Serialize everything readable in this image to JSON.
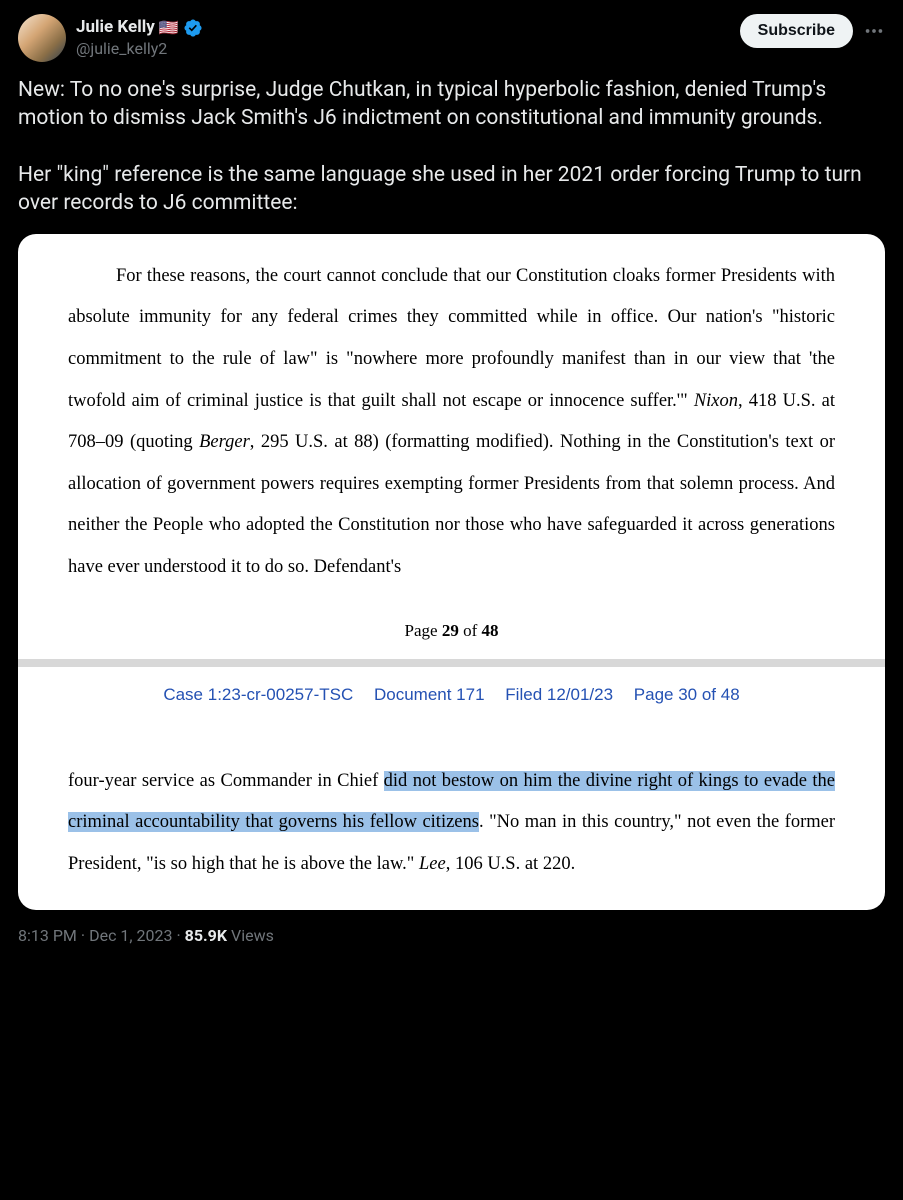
{
  "header": {
    "display_name": "Julie Kelly",
    "flag": "🇺🇸",
    "handle": "@julie_kelly2",
    "subscribe_label": "Subscribe"
  },
  "tweet": {
    "text": "New: To no one's surprise, Judge Chutkan, in typical hyperbolic fashion, denied Trump's motion to dismiss Jack Smith's J6 indictment on constitutional and immunity grounds.\n\nHer \"king\" reference is the same language she used in her 2021 order forcing Trump to turn over records to J6 committee:"
  },
  "document": {
    "page1": {
      "pre_nixon": "For these reasons, the court cannot conclude that our Constitution cloaks former Presidents with absolute immunity for any federal crimes they committed while in office.  Our nation's \"historic commitment to the rule of law\" is \"nowhere more profoundly manifest than in our view that 'the twofold aim of criminal justice is that guilt shall not escape or innocence suffer.'\"  ",
      "nixon_cite_name": "Nixon",
      "nixon_cite_rest": ", 418 U.S. at 708–09 (quoting ",
      "berger_cite_name": "Berger",
      "berger_cite_rest": ", 295 U.S. at 88) (formatting modified).  Nothing in the Constitution's text or allocation of government powers requires exempting former Presidents from that solemn process.  And neither the People who adopted the Constitution nor those who have safeguarded it across generations have ever understood it to do so.  Defendant's"
    },
    "page_marker": {
      "prefix": "Page ",
      "current": "29",
      "of": " of ",
      "total": "48"
    },
    "case_header": {
      "case_no": "Case 1:23-cr-00257-TSC",
      "doc_no": "Document 171",
      "filed": "Filed 12/01/23",
      "page": "Page 30 of 48"
    },
    "page2": {
      "pre_highlight": "four-year service as Commander in Chief ",
      "highlight": "did not bestow on him the divine right of kings to evade the criminal accountability that governs his fellow citizens",
      "post_highlight": ".  \"No man in this country,\" not even the former President, \"is so high that he is above the law.\"  ",
      "lee_cite_name": "Lee",
      "lee_cite_rest": ", 106 U.S. at 220."
    }
  },
  "meta": {
    "time": "8:13 PM",
    "date": "Dec 1, 2023",
    "views_count": "85.9K",
    "views_label": " Views"
  }
}
